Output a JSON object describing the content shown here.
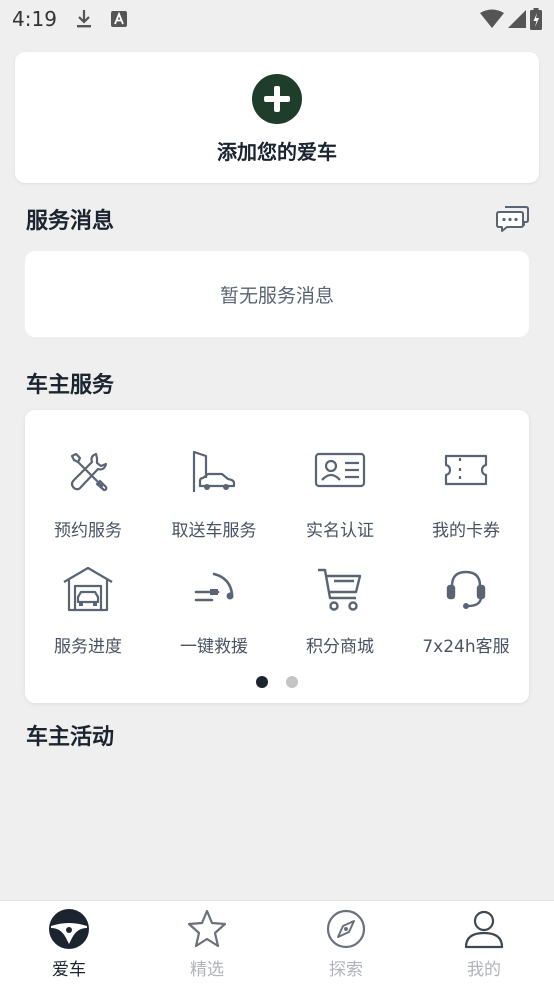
{
  "status_bar": {
    "time": "4:19"
  },
  "add_car": {
    "label": "添加您的爱车"
  },
  "service_messages": {
    "title": "服务消息",
    "empty_text": "暂无服务消息"
  },
  "owner_services": {
    "title": "车主服务",
    "items": [
      {
        "label": "预约服务",
        "icon": "wrench-screwdriver-icon"
      },
      {
        "label": "取送车服务",
        "icon": "car-pickup-icon"
      },
      {
        "label": "实名认证",
        "icon": "id-card-icon"
      },
      {
        "label": "我的卡券",
        "icon": "ticket-icon"
      },
      {
        "label": "服务进度",
        "icon": "garage-icon"
      },
      {
        "label": "一键救援",
        "icon": "tow-hook-icon"
      },
      {
        "label": "积分商城",
        "icon": "shopping-cart-icon"
      },
      {
        "label": "7x24h客服",
        "icon": "headset-icon"
      }
    ],
    "page_indicator": {
      "current": 1,
      "total": 2
    }
  },
  "owner_activities": {
    "title": "车主活动"
  },
  "tab_bar": {
    "tabs": [
      {
        "label": "爱车",
        "icon": "steering-wheel-icon",
        "active": true
      },
      {
        "label": "精选",
        "icon": "star-icon",
        "active": false
      },
      {
        "label": "探索",
        "icon": "compass-icon",
        "active": false
      },
      {
        "label": "我的",
        "icon": "person-icon",
        "active": false
      }
    ]
  },
  "colors": {
    "background": "#efefef",
    "card": "#ffffff",
    "accent_dark_green": "#1f3d2b",
    "text_primary": "#1c2430",
    "text_secondary": "#4a5361",
    "icon_gray": "#5b6473",
    "tab_inactive": "#b0b4ba",
    "dot_active": "#1c2430",
    "dot_inactive": "#c4c4c4"
  }
}
